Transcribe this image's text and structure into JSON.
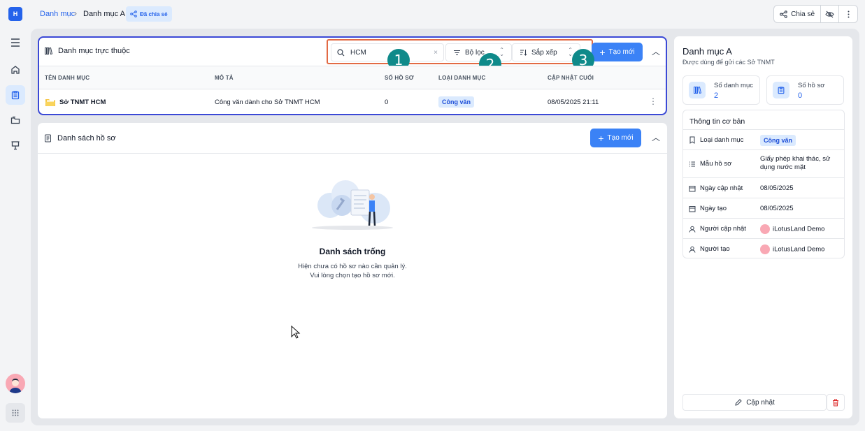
{
  "rail": {
    "logo": "H",
    "items": [
      "menu-icon",
      "home-icon",
      "clipboard-icon",
      "folder-icon",
      "presentation-icon"
    ]
  },
  "breadcrumb": {
    "parent": "Danh mục",
    "current": "Danh mục A",
    "shared_label": "Đã chia sẻ"
  },
  "top_actions": {
    "share_label": "Chia sẻ"
  },
  "sub_categories": {
    "title": "Danh mục trực thuộc",
    "search_value": "HCM",
    "filter_label": "Bộ lọc",
    "sort_label": "Sắp xếp",
    "create_label": "Tạo mới",
    "columns": [
      "TÊN DANH MỤC",
      "MÔ TẢ",
      "SỐ HỒ SƠ",
      "LOẠI DANH MỤC",
      "CẬP NHẬT CUỐI"
    ],
    "rows": [
      {
        "name": "Sở TNMT HCM",
        "description": "Công văn dành cho Sở TNMT HCM",
        "count": "0",
        "type": "Công văn",
        "updated": "08/05/2025 21:11"
      }
    ]
  },
  "annotations": [
    "1",
    "2",
    "3"
  ],
  "records": {
    "title": "Danh sách hồ sơ",
    "create_label": "Tạo mới",
    "empty_title": "Danh sách trống",
    "empty_line1": "Hiện chưa có hồ sơ nào cần quản lý.",
    "empty_line2": "Vui lòng chọn tạo hồ sơ mới."
  },
  "side": {
    "title": "Danh mục A",
    "subtitle": "Được dùng để gửi các Sở TNMT",
    "stats": [
      {
        "label": "Số danh mục",
        "value": "2"
      },
      {
        "label": "Số hồ sơ",
        "value": "0"
      }
    ],
    "info_title": "Thông tin cơ bản",
    "info": {
      "type_key": "Loại danh mục",
      "type_val": "Công văn",
      "template_key": "Mẫu hồ sơ",
      "template_val1": "Giấy phép khai thác, sử",
      "template_val2": "dụng nước mặt",
      "updated_key": "Ngày cập nhật",
      "updated_val": "08/05/2025",
      "created_key": "Ngày tạo",
      "created_val": "08/05/2025",
      "updater_key": "Người cập nhật",
      "updater_val": "iLotusLand Demo",
      "creator_key": "Người tạo",
      "creator_val": "iLotusLand Demo"
    },
    "update_label": "Cập nhật"
  },
  "colors": {
    "accent": "#3b82f6",
    "highlight_box": "#3b49d6",
    "toolbar_outline": "#e26a44",
    "annotation": "#0f8a8a"
  }
}
